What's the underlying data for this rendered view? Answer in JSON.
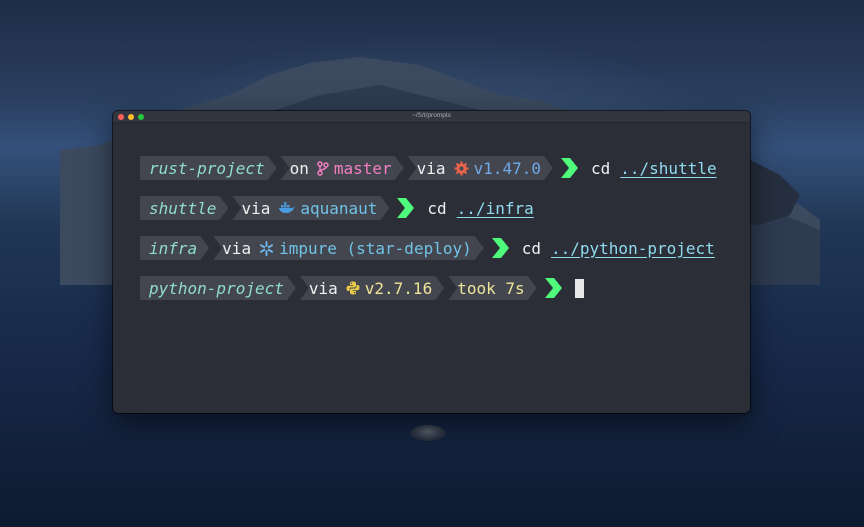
{
  "window": {
    "title": "~/S/t/prompts"
  },
  "lines": [
    {
      "dir": "rust-project",
      "branch_word": "on",
      "branch": "master",
      "via": "via",
      "version": "v1.47.0",
      "command": "cd",
      "arg": "../shuttle"
    },
    {
      "dir": "shuttle",
      "via": "via",
      "context": "aquanaut",
      "command": "cd",
      "arg": "../infra"
    },
    {
      "dir": "infra",
      "via": "via",
      "env": "impure (star-deploy)",
      "command": "cd",
      "arg": "../python-project"
    },
    {
      "dir": "python-project",
      "via": "via",
      "version": "v2.7.16",
      "duration": "took 7s"
    }
  ],
  "colors": {
    "prompt_arrow": "#50fa7b",
    "segment_bg": "#44464f",
    "terminal_bg": "#2b2d37"
  },
  "icons": [
    "git-branch-icon",
    "rust-gear-icon",
    "docker-whale-icon",
    "nix-snowflake-icon",
    "python-icon",
    "chevron-right-icon"
  ]
}
